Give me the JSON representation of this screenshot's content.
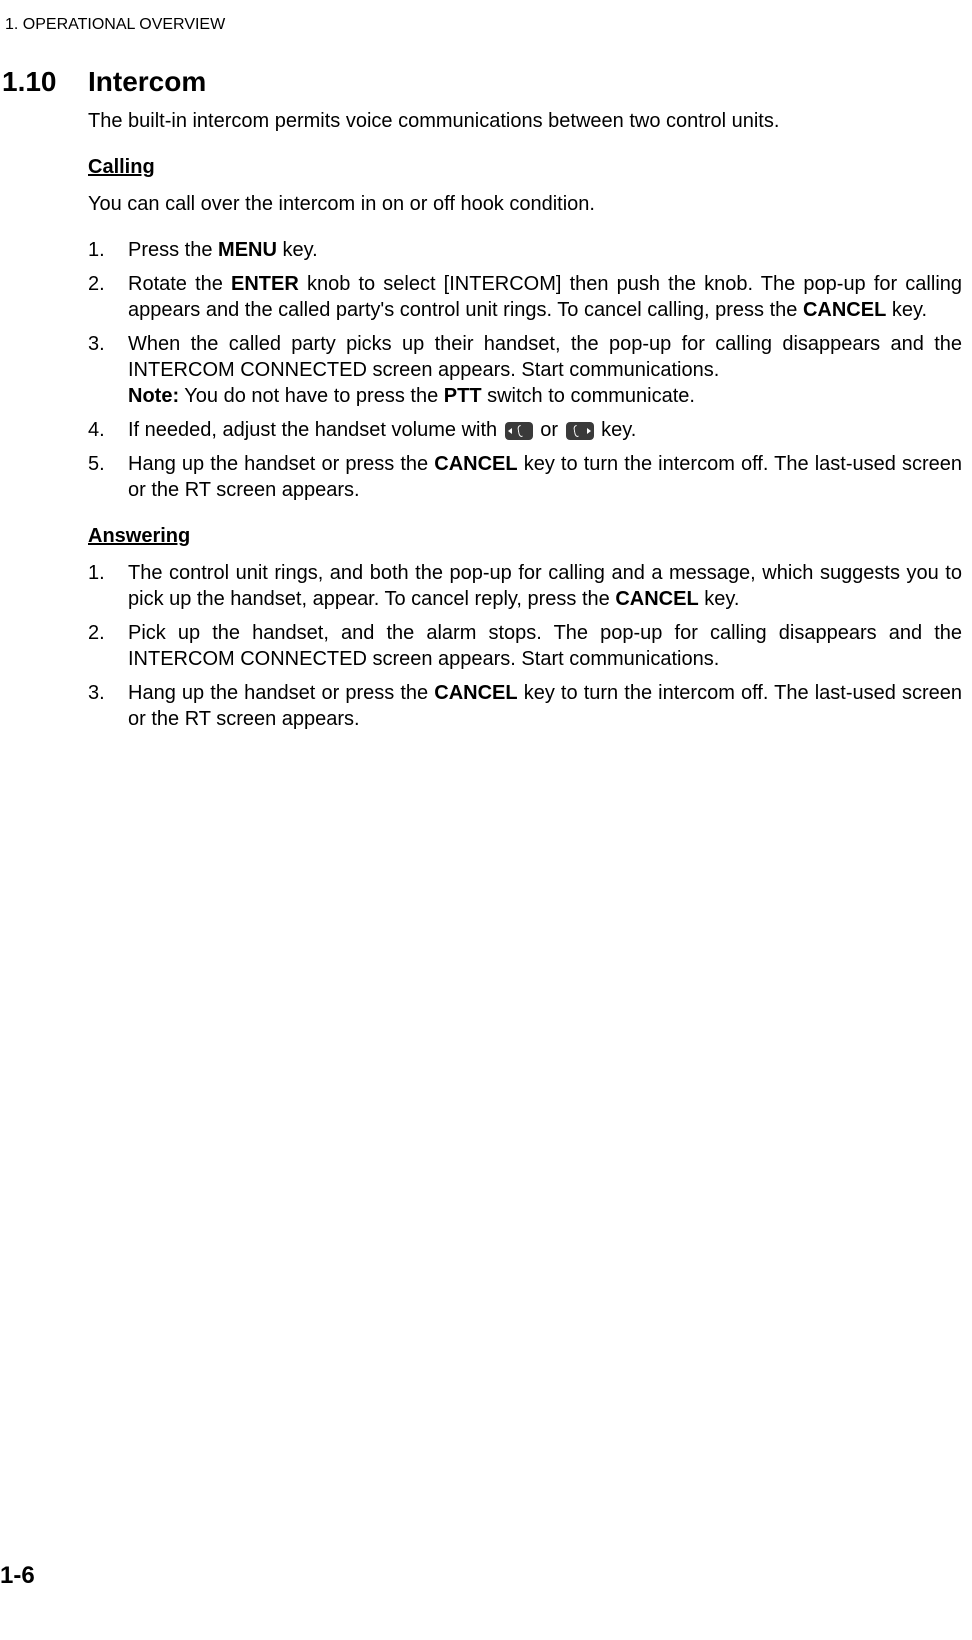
{
  "header": "1.  OPERATIONAL OVERVIEW",
  "section": {
    "number": "1.10",
    "title": "Intercom",
    "intro": "The built-in intercom permits voice communications between two control units."
  },
  "calling": {
    "heading": "Calling",
    "intro": "You can call over the intercom in on or off hook condition.",
    "steps": {
      "s1_pre": "Press the ",
      "s1_b1": "MENU",
      "s1_post": " key.",
      "s2_pre": "Rotate the ",
      "s2_b1": "ENTER",
      "s2_mid": " knob to select [INTERCOM] then push the knob. The pop-up for calling appears and the called party's control unit rings. To cancel calling, press the ",
      "s2_b2": "CANCEL",
      "s2_post": " key.",
      "s3_line1": "When the called party picks up their handset, the pop-up for calling disappears and the INTERCOM CONNECTED screen appears. Start communications.",
      "s3_note_b": "Note:",
      "s3_note_pre": " You do not have to press the ",
      "s3_note_b2": "PTT",
      "s3_note_post": " switch to communicate.",
      "s4_pre": "If needed, adjust the handset volume with ",
      "s4_or": " or ",
      "s4_post": " key.",
      "s5_pre": "Hang up the handset or press the ",
      "s5_b1": "CANCEL",
      "s5_post": " key to turn the intercom off. The last-used screen or the RT screen appears."
    }
  },
  "answering": {
    "heading": "Answering",
    "steps": {
      "s1_pre": "The control unit rings, and both the pop-up for calling and a message, which suggests you to pick up the handset, appear. To cancel reply, press the ",
      "s1_b1": "CANCEL",
      "s1_post": " key.",
      "s2": "Pick up the handset, and the alarm stops. The pop-up for calling disappears and the INTERCOM CONNECTED screen appears. Start communications.",
      "s3_pre": "Hang up the handset or press the ",
      "s3_b1": "CANCEL",
      "s3_post": " key to turn the intercom off. The last-used screen or the RT screen appears."
    }
  },
  "pageNumber": "1-6",
  "numbers": {
    "n1": "1.",
    "n2": "2.",
    "n3": "3.",
    "n4": "4.",
    "n5": "5."
  }
}
